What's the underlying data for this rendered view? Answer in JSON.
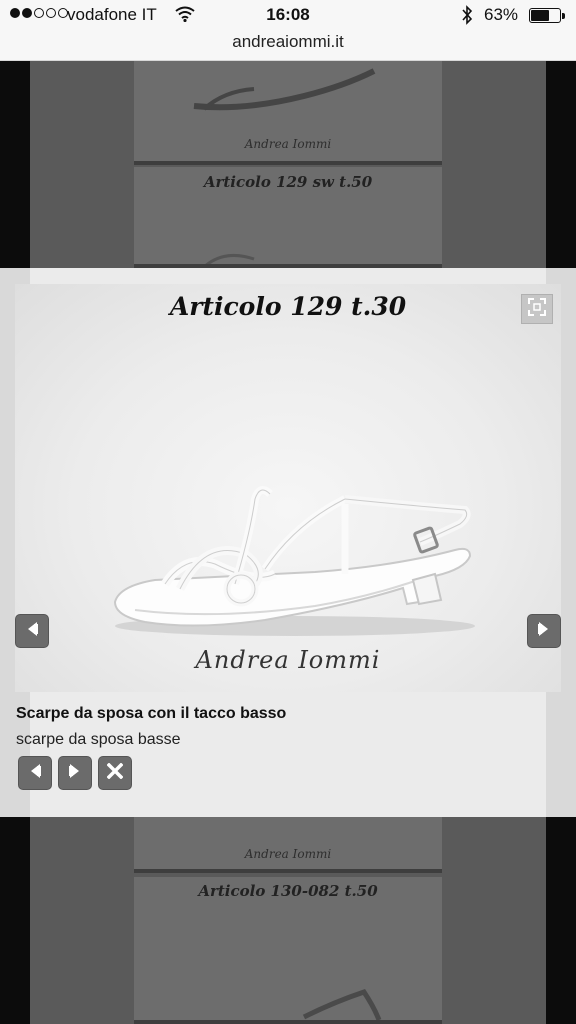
{
  "status_bar": {
    "carrier": "vodafone IT",
    "time": "16:08",
    "battery_percent": "63%",
    "battery_level": 0.63,
    "signal_bars_filled": 2,
    "signal_bars_total": 5
  },
  "address_bar": {
    "url": "andreaiommi.it"
  },
  "background_gallery": {
    "items": [
      {
        "caption": "",
        "signature": "Andrea Iommi"
      },
      {
        "caption": "Articolo 129 sw t.50"
      },
      {
        "caption": "",
        "signature": "Andrea Iommi"
      },
      {
        "caption": "Articolo 130-082 t.50"
      }
    ]
  },
  "lightbox": {
    "image_title": "Articolo 129 t.30",
    "image_signature": "Andrea Iommi",
    "title": "Scarpe da sposa con il tacco basso",
    "subtitle": "scarpe da sposa basse",
    "icons": {
      "expand": "expand-icon",
      "prev": "arrow-left-icon",
      "next": "arrow-right-icon",
      "close": "close-icon"
    }
  },
  "colors": {
    "overlay_dim": "#5a5a5a",
    "lightbox_bg": "#ebebeb",
    "control_button": "#6b6b6b"
  }
}
